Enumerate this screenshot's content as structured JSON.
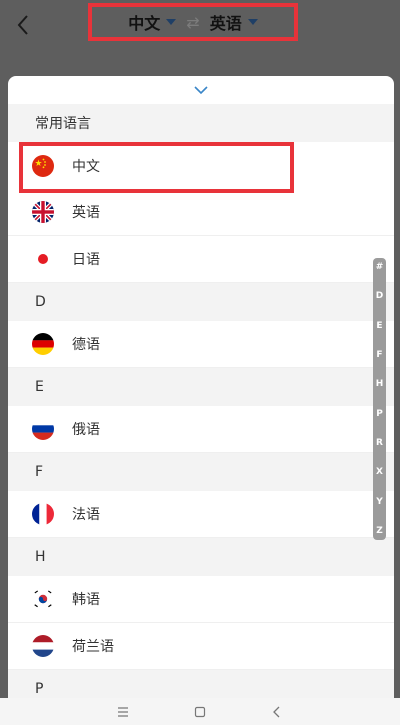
{
  "header": {
    "source_lang": "中文",
    "target_lang": "英语",
    "back_icon": "chevron-left-icon",
    "swap_icon": "swap-arrows-icon",
    "swap_glyph": "⇄"
  },
  "panel": {
    "collapse_icon": "chevron-down-icon",
    "sections": [
      {
        "title": "常用语言",
        "items": [
          {
            "label": "中文",
            "flag": "china",
            "highlighted": true
          },
          {
            "label": "英语",
            "flag": "uk"
          },
          {
            "label": "日语",
            "flag": "japan"
          }
        ]
      },
      {
        "title": "D",
        "items": [
          {
            "label": "德语",
            "flag": "germany"
          }
        ]
      },
      {
        "title": "E",
        "items": [
          {
            "label": "俄语",
            "flag": "russia"
          }
        ]
      },
      {
        "title": "F",
        "items": [
          {
            "label": "法语",
            "flag": "france"
          }
        ]
      },
      {
        "title": "H",
        "items": [
          {
            "label": "韩语",
            "flag": "korea"
          },
          {
            "label": "荷兰语",
            "flag": "netherlands"
          }
        ]
      },
      {
        "title": "P",
        "items": []
      }
    ]
  },
  "alpha_index": [
    "#",
    "D",
    "E",
    "F",
    "H",
    "P",
    "R",
    "X",
    "Y",
    "Z"
  ],
  "bottom_nav": {
    "menu_icon": "menu-icon",
    "home_icon": "square-home-icon",
    "back_icon": "back-arrow-icon"
  },
  "colors": {
    "accent_red": "#e8333a",
    "topbar_bg": "#5e5e5e",
    "dropdown_triangle": "#1f3f66"
  }
}
